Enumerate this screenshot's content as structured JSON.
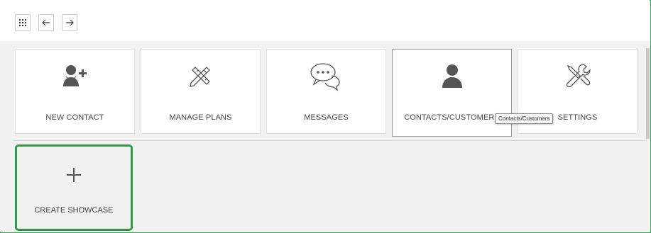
{
  "toolbar": {
    "apps_icon": "grid-icon",
    "back_icon": "arrow-left-icon",
    "forward_icon": "arrow-right-icon"
  },
  "tiles": [
    {
      "label": "NEW CONTACT",
      "icon": "add-person-icon"
    },
    {
      "label": "MANAGE PLANS",
      "icon": "pencil-ruler-icon"
    },
    {
      "label": "MESSAGES",
      "icon": "chat-bubbles-icon"
    },
    {
      "label": "CONTACTS/CUSTOMERS",
      "icon": "person-icon"
    },
    {
      "label": "SETTINGS",
      "icon": "wrench-screwdriver-icon"
    }
  ],
  "create_tile": {
    "label": "CREATE SHOWCASE",
    "icon": "plus-icon"
  },
  "tooltip": {
    "text": "Contacts/Customers"
  },
  "colors": {
    "highlight_border": "#2e9a45",
    "frame_border": "#3aa655",
    "workspace_bg": "#f1f1f1",
    "icon": "#555555"
  }
}
